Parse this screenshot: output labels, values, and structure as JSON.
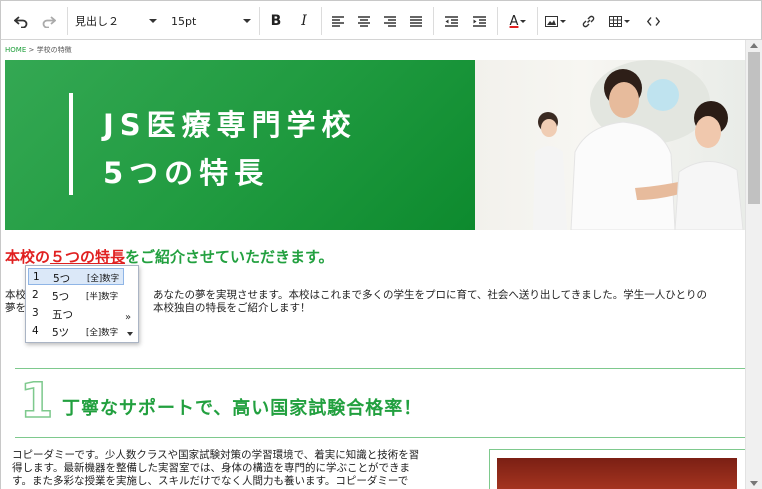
{
  "toolbar": {
    "undo_icon": "undo-icon",
    "redo_icon": "redo-icon",
    "block_format": "見出し２",
    "font_size": "15pt",
    "bold_label": "B",
    "italic_label": "I",
    "font_color_label": "A",
    "font_color": "#e02020"
  },
  "breadcrumb": {
    "home": "HOME",
    "separator": " > ",
    "current": "学校の特徴"
  },
  "hero": {
    "line1": "JS医療専門学校",
    "line2": "5つの特長"
  },
  "intro": {
    "title_red": "本校の",
    "title_underlined": "５つの特長",
    "title_green": "をご紹介させていただきます。",
    "text_line1_prefix": "本校",
    "text_line1_suffix": "あなたの夢を実現させます。本校はこれまで多くの学生をプロに育て、社会へ送り出してきました。学生一人ひとりの",
    "text_line2_prefix": "夢を",
    "text_line2_suffix": "本校独自の特長をご紹介します！"
  },
  "ime": {
    "candidates": [
      {
        "num": "1",
        "text": "5つ",
        "note": "[全]数字"
      },
      {
        "num": "2",
        "text": "5つ",
        "note": "[半]数字"
      },
      {
        "num": "3",
        "text": "五つ",
        "note": ""
      },
      {
        "num": "4",
        "text": "5ツ",
        "note": "[全]数字"
      }
    ],
    "more": "»"
  },
  "section": {
    "number": "1",
    "title": "丁寧なサポートで、高い国家試験合格率！",
    "body_line1": "コピーダミーです。少人数クラスや国家試験対策の学習環境で、着実に知識と技術を習",
    "body_line2": "得します。最新機器を整備した実習室では、身体の構造を専門的に学ぶことができま",
    "body_line3": "す。また多彩な授業を実施し、スキルだけでなく人間力も養います。コピーダミーで"
  },
  "colors": {
    "brand_green": "#22a03f",
    "accent_red": "#e02020"
  }
}
